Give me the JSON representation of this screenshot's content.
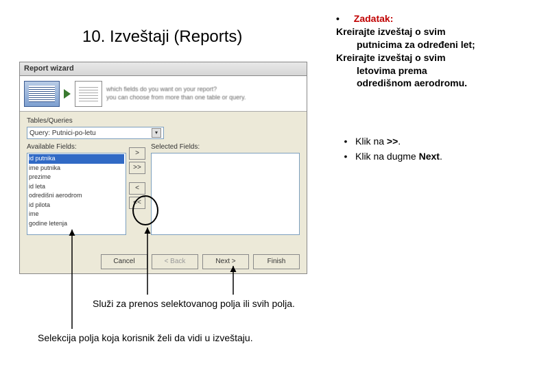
{
  "title": "10. Izveštaji (Reports)",
  "task": {
    "label": "Zadatak:",
    "line1a": "Kreirajte izveštaj o svim",
    "line1b": "putnicima za određeni let;",
    "line2a": "Kreirajte izveštaj o svim",
    "line2b": "letovima prema",
    "line2c": "odredišnom aerodromu."
  },
  "clicks": {
    "a_prefix": "Klik na ",
    "a_bold": ">>",
    "a_suffix": ".",
    "b_prefix": "Klik na dugme ",
    "b_bold": "Next",
    "b_suffix": "."
  },
  "wizard": {
    "title": "Report wizard",
    "header_q": "which fields do you want on your report?",
    "header_hint": "you can choose from more than one table or query.",
    "tables_queries_label": "Tables/Queries",
    "combo_value": "Query: Putnici-po-letu",
    "available_label": "Available Fields:",
    "selected_label": "Selected Fields:",
    "available_fields": [
      "id putnika",
      "ime putnika",
      "prezime",
      "id leta",
      "odredišni aerodrom",
      "id pilota",
      "ime",
      "godine letenja"
    ],
    "btn_gt": ">",
    "btn_gg": ">>",
    "btn_lt": "<",
    "btn_ll": "<<",
    "footer": {
      "cancel": "Cancel",
      "back": "< Back",
      "next": "Next >",
      "finish": "Finish"
    }
  },
  "caption_transfer": "Služi za prenos selektovanog polja ili svih polja.",
  "caption_select": "Selekcija polja koja korisnik želi da vidi u izveštaju."
}
